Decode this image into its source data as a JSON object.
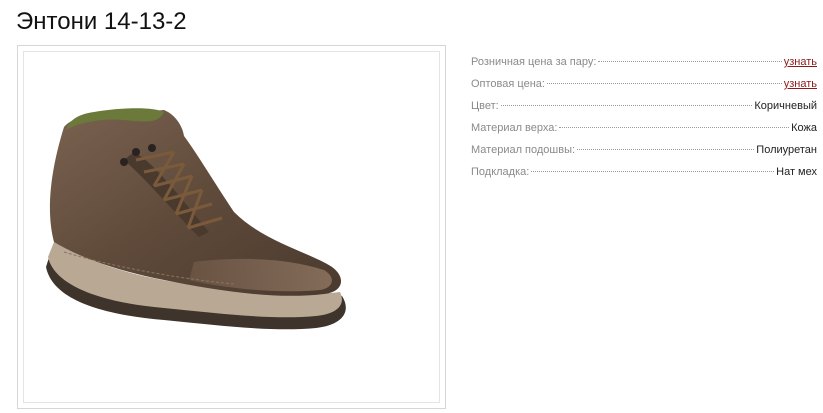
{
  "product": {
    "title": "Энтони 14-13-2",
    "image_icon": "shoe-photo"
  },
  "specs": [
    {
      "label": "Розничная цена за пару:",
      "value": "узнать",
      "is_link": true
    },
    {
      "label": "Оптовая цена:",
      "value": "узнать",
      "is_link": true
    },
    {
      "label": "Цвет:",
      "value": "Коричневый",
      "is_link": false
    },
    {
      "label": "Материал верха:",
      "value": "Кожа",
      "is_link": false
    },
    {
      "label": "Материал подошвы:",
      "value": "Полиуретан",
      "is_link": false
    },
    {
      "label": "Подкладка:",
      "value": "Нат мех",
      "is_link": false
    }
  ],
  "colors": {
    "link": "#8b1a1a",
    "label": "#8a8a8a",
    "value": "#222222",
    "frame_border": "#d6d6d6"
  }
}
